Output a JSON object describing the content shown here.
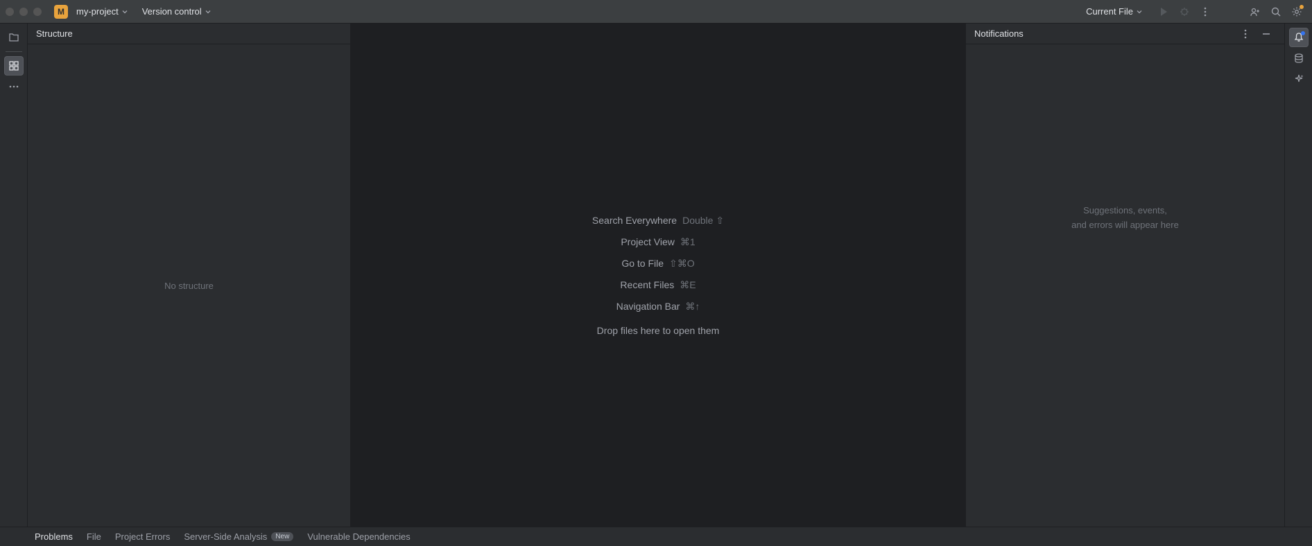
{
  "titleBar": {
    "projectBadge": "M",
    "projectName": "my-project",
    "versionControl": "Version control",
    "currentFile": "Current File"
  },
  "structurePanel": {
    "title": "Structure",
    "empty": "No structure"
  },
  "editor": {
    "actions": [
      {
        "label": "Search Everywhere",
        "shortcut": "Double ⇧"
      },
      {
        "label": "Project View",
        "shortcut": "⌘1"
      },
      {
        "label": "Go to File",
        "shortcut": "⇧⌘O"
      },
      {
        "label": "Recent Files",
        "shortcut": "⌘E"
      },
      {
        "label": "Navigation Bar",
        "shortcut": "⌘↑"
      }
    ],
    "dropHint": "Drop files here to open them"
  },
  "notifications": {
    "title": "Notifications",
    "emptyLine1": "Suggestions, events,",
    "emptyLine2": "and errors will appear here"
  },
  "bottomBar": {
    "problems": "Problems",
    "file": "File",
    "projectErrors": "Project Errors",
    "serverSide": "Server-Side Analysis",
    "newBadge": "New",
    "vulnerable": "Vulnerable Dependencies"
  }
}
